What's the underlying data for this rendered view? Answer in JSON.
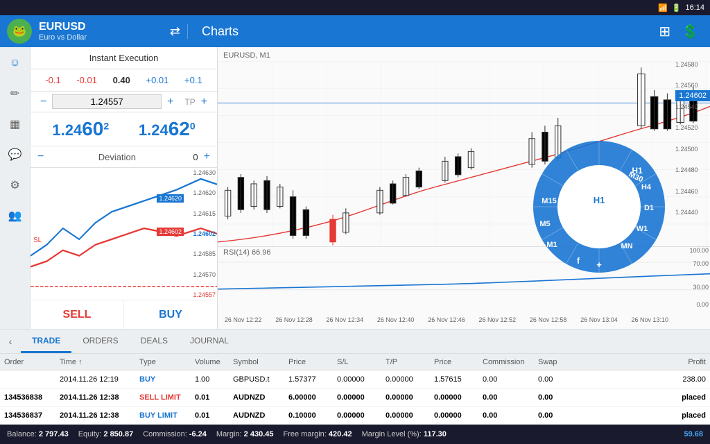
{
  "statusBar": {
    "time": "16:14",
    "icons": [
      "signal",
      "wifi",
      "battery"
    ]
  },
  "header": {
    "symbol": "EURUSD",
    "subtitle": "Euro vs Dollar",
    "section": "Charts",
    "exchangeIcon": "⇄",
    "newWindowIcon": "⊞",
    "tradeIcon": "$"
  },
  "sideIcons": [
    {
      "name": "profile-icon",
      "glyph": "☺"
    },
    {
      "name": "pen-icon",
      "glyph": "✎"
    },
    {
      "name": "document-icon",
      "glyph": "▦"
    },
    {
      "name": "chat-icon",
      "glyph": "💬"
    },
    {
      "name": "settings-icon",
      "glyph": "⚙"
    },
    {
      "name": "people-icon",
      "glyph": "👥"
    }
  ],
  "tradePanel": {
    "title": "Instant Execution",
    "adjustments": [
      "-0.1",
      "-0.01",
      "0.40",
      "+0.01",
      "+0.1"
    ],
    "slPrice": "1.24557",
    "tpLabel": "TP",
    "bidLabel": "1.24",
    "bidSup": "60",
    "bidSup2": "2",
    "askLabel": "1.24",
    "askSup": "62",
    "askSup2": "0",
    "deviationLabel": "Deviation",
    "deviationValue": "0",
    "miniChartPrices": [
      "1.24630",
      "1.24620",
      "1.24615",
      "1.24602",
      "1.24585",
      "1.24570",
      "1.24557"
    ],
    "slLabel": "SL",
    "slLinePrice": "1.24557",
    "blueLinePrice": "1.24620",
    "redLinePrice": "1.24602",
    "sellLabel": "SELL",
    "buyLabel": "BUY"
  },
  "chart": {
    "label": "EURUSD, M1",
    "currentPrice": "1.24602",
    "rsiLabel": "RSI(14) 66.96",
    "timeLabels": [
      "26 Nov 12:22",
      "26 Nov 12:28",
      "26 Nov 12:34",
      "26 Nov 12:40",
      "26 Nov 12:46",
      "26 Nov 12:52",
      "26 Nov 12:58",
      "26 Nov 13:04",
      "26 Nov 13:10"
    ],
    "priceLabels": [
      "1.24580",
      "1.24560",
      "1.24540",
      "1.24520",
      "1.24500",
      "1.24480",
      "1.24460",
      "1.24440"
    ],
    "rsiValues": [
      "100.00",
      "70.00",
      "30.00",
      "0.00"
    ]
  },
  "timeframeWheel": {
    "segments": [
      "M30",
      "H1",
      "H4",
      "D1",
      "W1",
      "MN",
      "f+",
      "M1",
      "M5",
      "M15"
    ]
  },
  "tabs": {
    "arrow": "‹",
    "items": [
      "TRADE",
      "ORDERS",
      "DEALS",
      "JOURNAL"
    ],
    "active": "TRADE"
  },
  "tableHeader": {
    "columns": [
      "Order",
      "Time ↑",
      "Type",
      "Volume",
      "Symbol",
      "Price",
      "S/L",
      "T/P",
      "Price",
      "Commission",
      "Swap",
      "Profit"
    ]
  },
  "tableRows": [
    {
      "order": "",
      "time": "2014.11.26 12:19",
      "type": "BUY",
      "typeClass": "buy",
      "volume": "1.00",
      "symbol": "GBPUSD.t",
      "price": "1.57377",
      "sl": "0.00000",
      "tp": "0.00000",
      "price2": "1.57615",
      "commission": "0.00",
      "swap": "0.00",
      "profit": "238.00",
      "profitClass": ""
    },
    {
      "order": "134536838",
      "time": "2014.11.26 12:38",
      "type": "SELL LIMIT",
      "typeClass": "sell",
      "volume": "0.01",
      "symbol": "AUDNZD",
      "price": "6.00000",
      "sl": "0.00000",
      "tp": "0.00000",
      "price2": "0.00000",
      "commission": "0.00",
      "swap": "0.00",
      "profit": "placed",
      "profitClass": ""
    },
    {
      "order": "134536837",
      "time": "2014.11.26 12:38",
      "type": "BUY LIMIT",
      "typeClass": "buy",
      "volume": "0.01",
      "symbol": "AUDNZD",
      "price": "0.10000",
      "sl": "0.00000",
      "tp": "0.00000",
      "price2": "0.00000",
      "commission": "0.00",
      "swap": "0.00",
      "profit": "placed",
      "profitClass": ""
    }
  ],
  "balanceBar": {
    "items": [
      {
        "label": "Balance:",
        "value": "2 797.43"
      },
      {
        "label": "Equity:",
        "value": "2 850.87"
      },
      {
        "label": "Commission:",
        "value": "-6.24"
      },
      {
        "label": "Margin:",
        "value": "2 430.45"
      },
      {
        "label": "Free margin:",
        "value": "420.42"
      },
      {
        "label": "Margin Level (%):",
        "value": "117.30"
      },
      {
        "label": "",
        "value": "59.68",
        "class": "blue"
      }
    ]
  }
}
